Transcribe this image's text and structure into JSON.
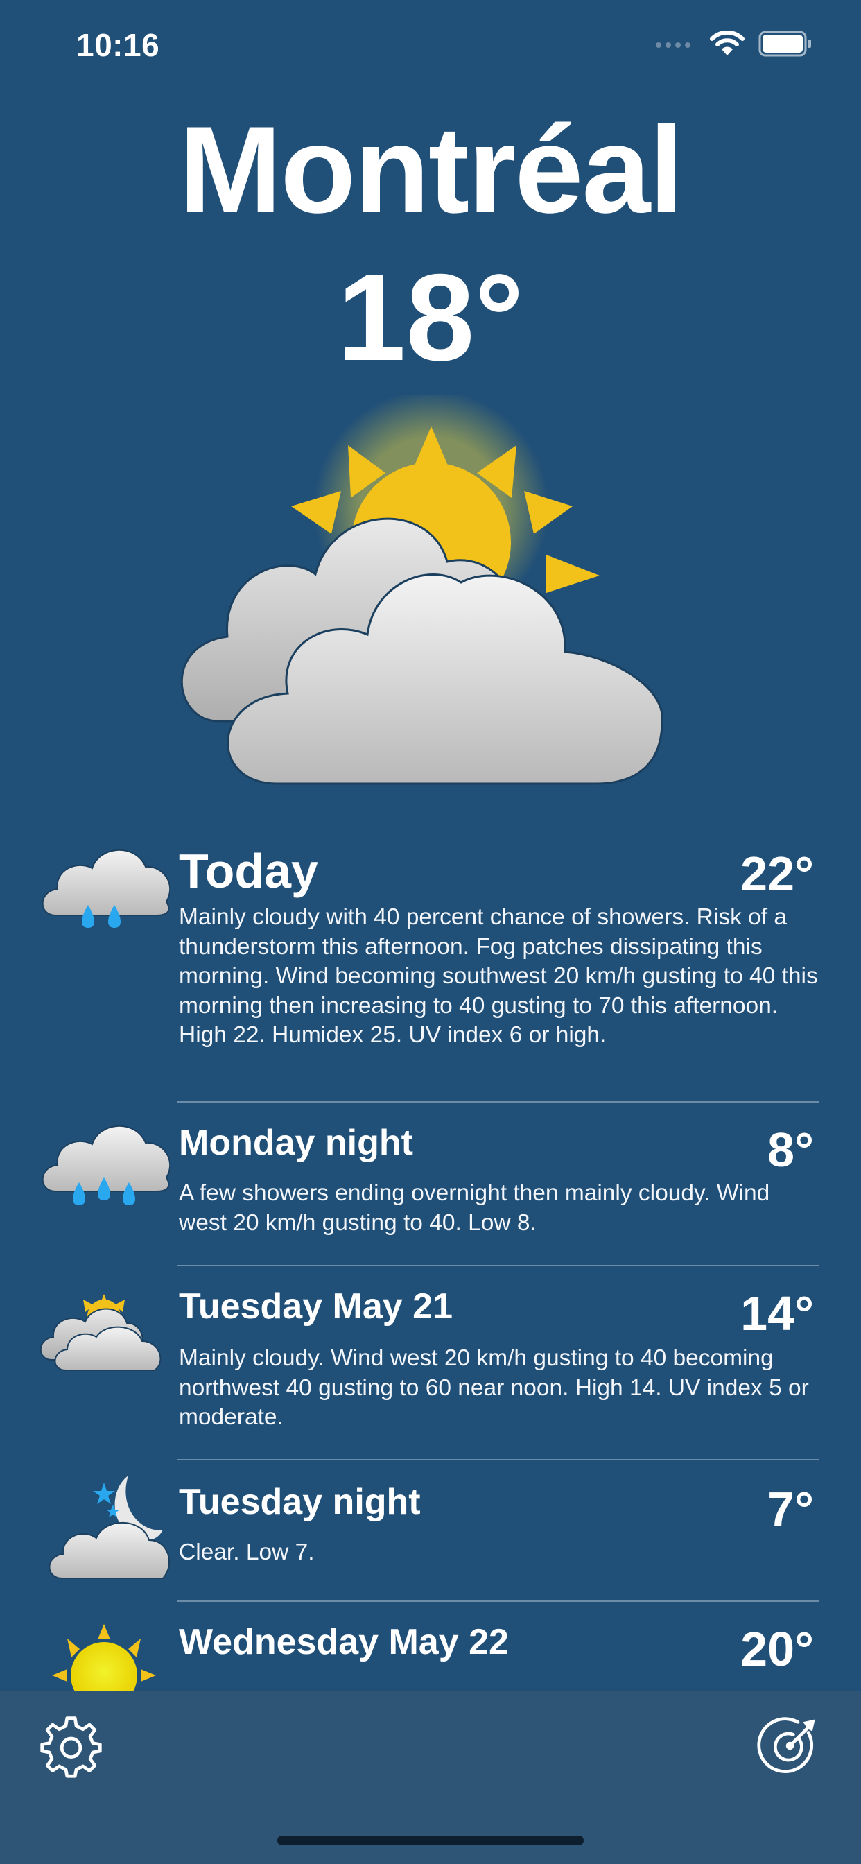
{
  "status_bar": {
    "time": "10:16",
    "icons": [
      "cellular-icon",
      "wifi-icon",
      "battery-icon"
    ]
  },
  "current": {
    "city": "Montréal",
    "temperature": "18°",
    "condition_icon": "partly-cloudy-icon"
  },
  "forecast": [
    {
      "period": "Today",
      "temperature": "22°",
      "icon": "rain-cloud-icon",
      "description": "Mainly cloudy with 40 percent chance of showers. Risk of a thunderstorm this afternoon. Fog patches dissipating this morning. Wind becoming southwest 20 km/h gusting to 40 this morning then increasing to 40 gusting to 70 this afternoon. High 22. Humidex 25. UV index 6 or high."
    },
    {
      "period": "Monday night",
      "temperature": "8°",
      "icon": "rain-cloud-icon",
      "description": "A few showers ending overnight then mainly cloudy. Wind west 20 km/h gusting to 40. Low 8."
    },
    {
      "period": "Tuesday May 21",
      "temperature": "14°",
      "icon": "partly-cloudy-icon",
      "description": "Mainly cloudy. Wind west 20 km/h gusting to 40 becoming northwest 40 gusting to 60 near noon. High 14. UV index 5 or moderate."
    },
    {
      "period": "Tuesday night",
      "temperature": "7°",
      "icon": "moon-cloud-icon",
      "description": "Clear. Low 7."
    },
    {
      "period": "Wednesday May 22",
      "temperature": "20°",
      "icon": "sun-icon",
      "description": ""
    }
  ],
  "toolbar": {
    "settings_icon": "gear-icon",
    "radar_icon": "radar-icon"
  },
  "colors": {
    "background": "#204f78",
    "toolbar": "#2e5576",
    "sun": "#f2c21b",
    "rain": "#29a8f0",
    "text": "#ffffff"
  }
}
